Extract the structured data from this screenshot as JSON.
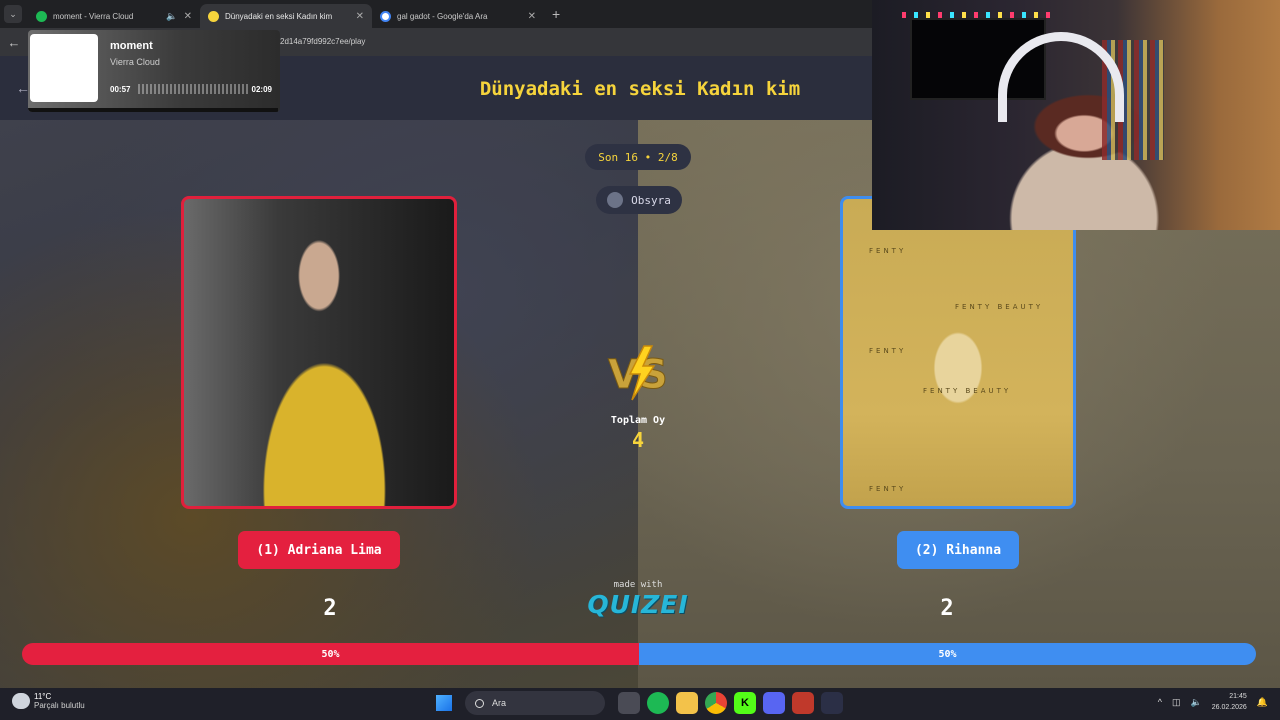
{
  "browser": {
    "tabs": [
      {
        "title": "moment - Vierra Cloud",
        "icon": "spotify-icon",
        "color": "#1db954",
        "active": false
      },
      {
        "title": "Dünyadaki en seksi Kadın kim",
        "icon": "quizei-icon",
        "color": "#f6d43c",
        "active": true
      },
      {
        "title": "gal gadot - Google'da Ara",
        "icon": "google-icon",
        "color": "#ffffff",
        "active": false
      }
    ],
    "url": "2d14a79fd992c7ee/play"
  },
  "media": {
    "song": "moment",
    "artist": "Vierra Cloud",
    "elapsed": "00:57",
    "duration": "02:09"
  },
  "quiz": {
    "title": "Dünyadaki en seksi Kadın kim",
    "round": "Son 16 • 2/8",
    "user": "Obsyra",
    "total_label": "Toplam Oy",
    "total_votes": "4",
    "made_with": "made with",
    "brand": "QUIZEI",
    "left": {
      "label": "(1) Adriana Lima",
      "score": "2",
      "percent_label": "50%",
      "percent": 50,
      "color": "#e4203f"
    },
    "right": {
      "label": "(2) Rihanna",
      "score": "2",
      "percent_label": "50%",
      "percent": 50,
      "color": "#3f8ef1"
    },
    "right_photo_captions": [
      "FENTY",
      "FENTY BEAUTY",
      "FENTY",
      "FENTY BEAUTY",
      "FENTY"
    ]
  },
  "taskbar": {
    "weather_temp": "11°C",
    "weather_desc": "Parçalı bulutlu",
    "search_placeholder": "Ara",
    "time": "21:45",
    "date": "26.02.2026"
  }
}
